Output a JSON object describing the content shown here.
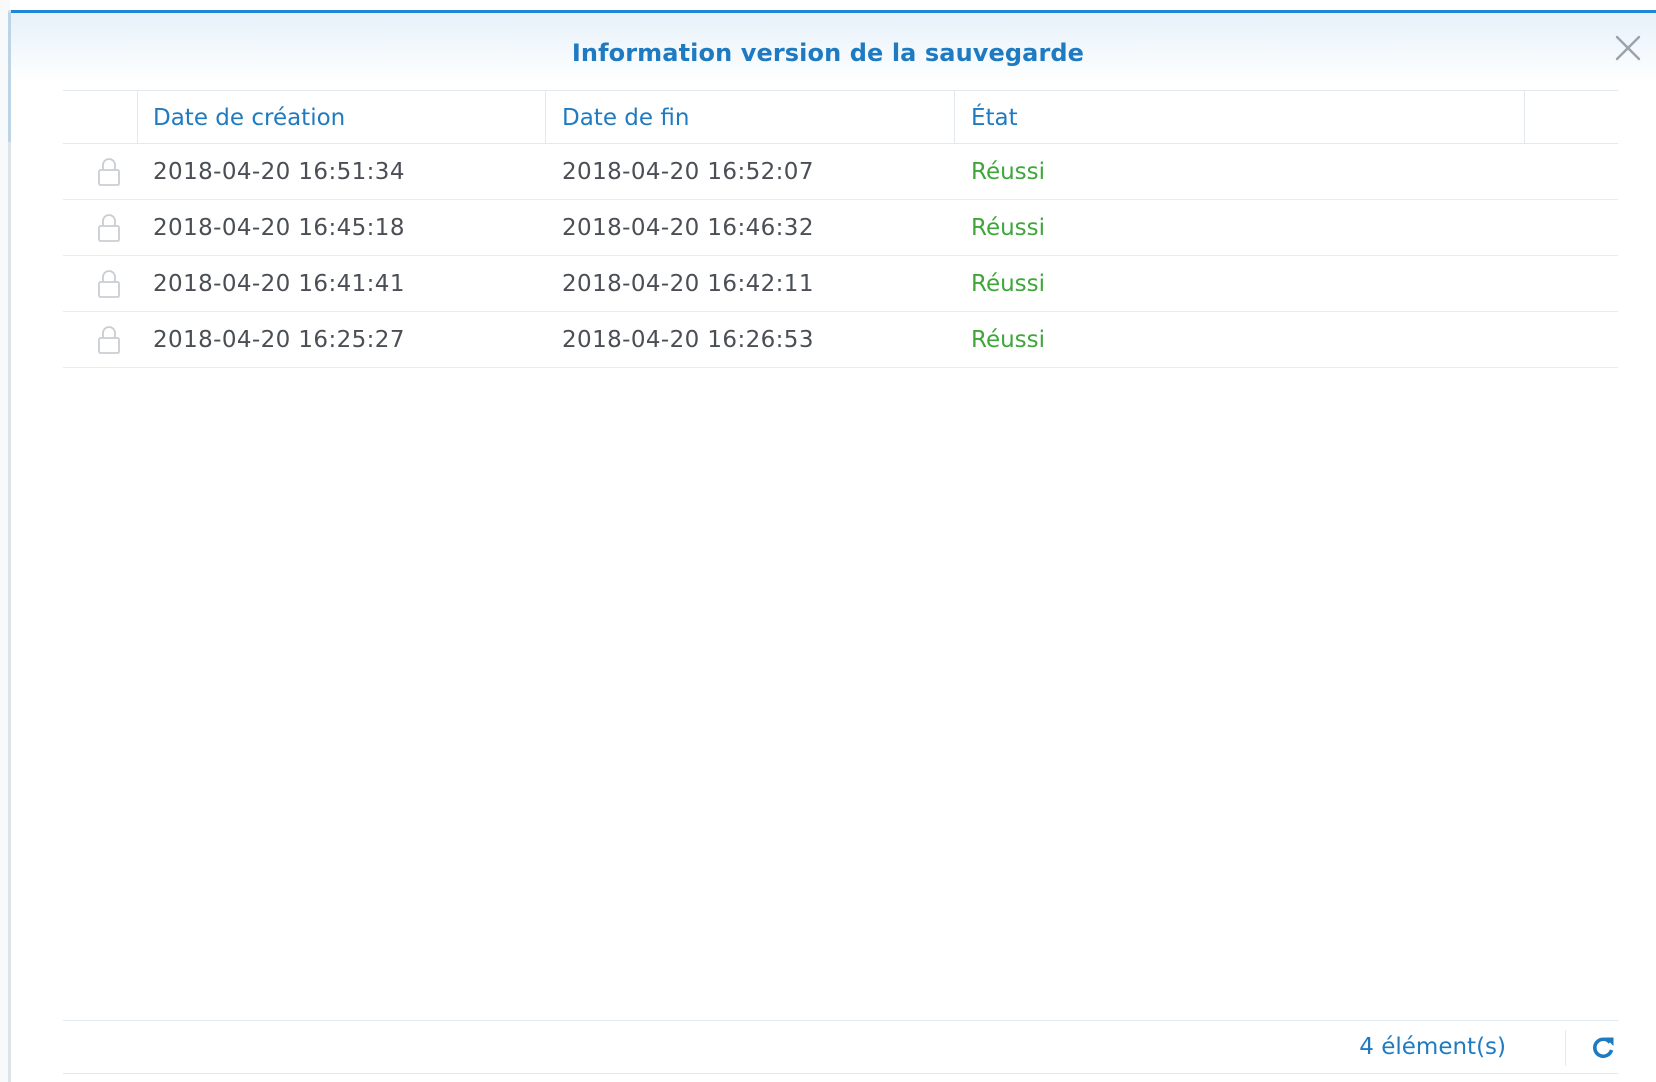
{
  "dialog": {
    "title": "Information version de la sauvegarde",
    "close_icon": "close-icon",
    "accent_color": "#1f86d6"
  },
  "table": {
    "columns": [
      {
        "label": "Date de création"
      },
      {
        "label": "Date de fin"
      },
      {
        "label": "État"
      }
    ],
    "rows": [
      {
        "lock_icon": "lock-icon",
        "created": "2018-04-20 16:51:34",
        "finished": "2018-04-20 16:52:07",
        "status": "Réussi"
      },
      {
        "lock_icon": "lock-icon",
        "created": "2018-04-20 16:45:18",
        "finished": "2018-04-20 16:46:32",
        "status": "Réussi"
      },
      {
        "lock_icon": "lock-icon",
        "created": "2018-04-20 16:41:41",
        "finished": "2018-04-20 16:42:11",
        "status": "Réussi"
      },
      {
        "lock_icon": "lock-icon",
        "created": "2018-04-20 16:25:27",
        "finished": "2018-04-20 16:26:53",
        "status": "Réussi"
      }
    ],
    "status_color": "#3ea63a",
    "header_color": "#1f7bc1"
  },
  "footer": {
    "count": "4 élément(s)",
    "refresh_icon": "refresh-icon"
  }
}
